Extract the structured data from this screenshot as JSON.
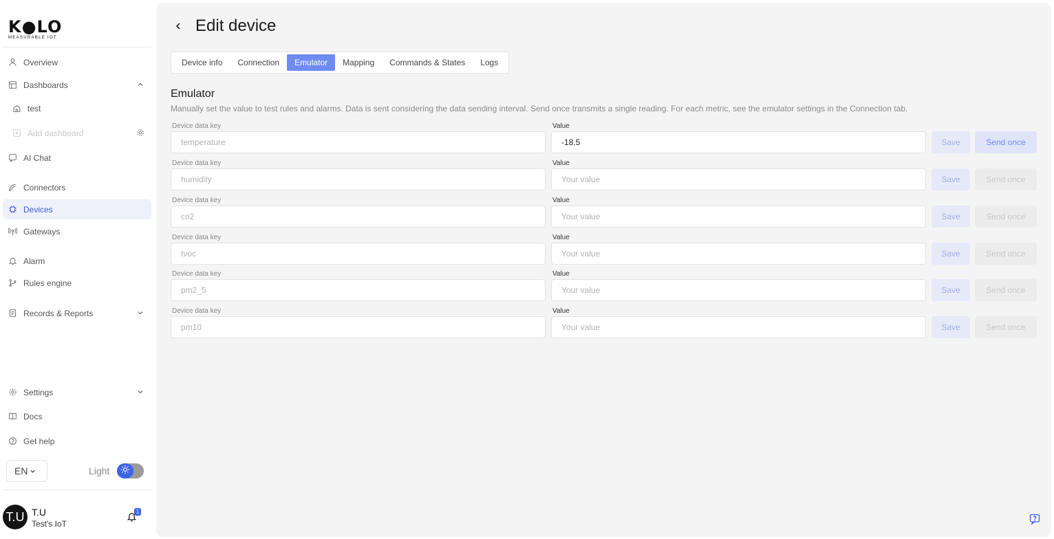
{
  "brand": {
    "name": "K●LO",
    "tagline": "MEASURABLE IOT"
  },
  "sidebar": {
    "overview": "Overview",
    "dashboards": "Dashboards",
    "dashboard_test": "test",
    "add_dashboard": "Add dashboard",
    "ai_chat": "AI Chat",
    "connectors": "Connectors",
    "devices": "Devices",
    "gateways": "Gateways",
    "alarm": "Alarm",
    "rules_engine": "Rules engine",
    "records_reports": "Records & Reports",
    "settings": "Settings",
    "docs": "Docs",
    "get_help": "Get help"
  },
  "footer": {
    "language": "EN",
    "theme_label": "Light",
    "avatar_initials": "T.U",
    "user_name": "T.U",
    "org_name": "Test's IoT",
    "notification_count": "1"
  },
  "page": {
    "title": "Edit device",
    "tabs": [
      "Device info",
      "Connection",
      "Emulator",
      "Mapping",
      "Commands & States",
      "Logs"
    ],
    "active_tab": "Emulator",
    "section_title": "Emulator",
    "section_desc": "Manually set the value to test rules and alarms. Data is sent considering the data sending interval. Send once transmits a single reading. For each metric, see the emulator settings in the Connection tab."
  },
  "emulator": {
    "key_label": "Device data key",
    "value_label": "Value",
    "value_placeholder": "Your value",
    "save_label": "Save",
    "send_label": "Send once",
    "rows": [
      {
        "key": "temperature",
        "value": "-18.5"
      },
      {
        "key": "humidity",
        "value": ""
      },
      {
        "key": "co2",
        "value": ""
      },
      {
        "key": "tvoc",
        "value": ""
      },
      {
        "key": "pm2_5",
        "value": ""
      },
      {
        "key": "pm10",
        "value": ""
      }
    ]
  },
  "colors": {
    "accent": "#3d63e8",
    "active_tab": "#6d8bf0",
    "active_nav_bg": "#eef0fb"
  }
}
